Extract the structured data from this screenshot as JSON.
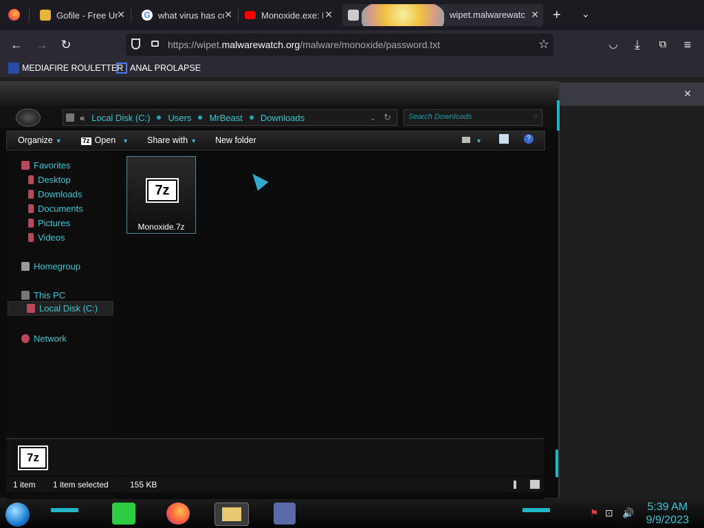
{
  "browser": {
    "tabs": [
      {
        "title": "Gofile - Free Unlimited",
        "icon": "gofile-icon"
      },
      {
        "title": "what virus has code",
        "icon": "google-icon"
      },
      {
        "title": "Monoxide.exe: Malware",
        "icon": "youtube-icon"
      },
      {
        "title": "wipet.malwarewatch.org",
        "icon": "page-icon"
      }
    ],
    "url_prefix": "https://wipet.",
    "url_domain": "malwarewatch.org",
    "url_path": "/malware/monoxide/password.txt",
    "bookmarks": [
      {
        "label": "MEDIAFIRE ROULETTER",
        "icon": "mediafire-icon"
      },
      {
        "label": "ANAL PROLAPSE",
        "icon": "bookmark-icon"
      }
    ]
  },
  "explorer": {
    "breadcrumb_prefix": "«",
    "breadcrumbs": [
      "Local Disk (C:)",
      "Users",
      "MrBeast",
      "Downloads"
    ],
    "search_placeholder": "Search Downloads",
    "toolbar": {
      "organize": "Organize",
      "open": "Open",
      "open_icon_text": "7z",
      "share_with": "Share with",
      "new_folder": "New folder"
    },
    "nav": {
      "favorites": "Favorites",
      "desktop": "Desktop",
      "downloads": "Downloads",
      "documents": "Documents",
      "pictures": "Pictures",
      "videos": "Videos",
      "homegroup": "Homegroup",
      "this_pc": "This PC",
      "local_disk": "Local Disk (C:)",
      "network": "Network"
    },
    "file": {
      "name": "Monoxide.7z",
      "icon_text": "7z"
    },
    "details_icon_text": "7z",
    "status": {
      "count": "1 item",
      "selected": "1 item selected",
      "size": "155 KB"
    }
  },
  "taskbar": {
    "time": "5:39 AM",
    "date": "9/9/2023"
  },
  "colors": {
    "accent": "#39c8d6",
    "firefox_tab_bg": "#1c1b22",
    "firefox_nav_bg": "#2b2a33"
  }
}
